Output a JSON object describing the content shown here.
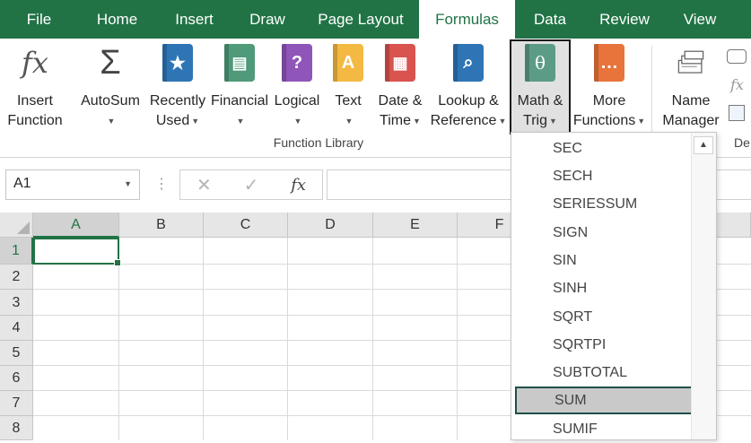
{
  "menu": {
    "tabs": [
      {
        "label": "File"
      },
      {
        "label": "Home"
      },
      {
        "label": "Insert"
      },
      {
        "label": "Draw"
      },
      {
        "label": "Page Layout"
      },
      {
        "label": "Formulas",
        "active": true
      },
      {
        "label": "Data"
      },
      {
        "label": "Review"
      },
      {
        "label": "View"
      }
    ]
  },
  "ribbon": {
    "insert_function": {
      "line1": "Insert",
      "line2": "Function",
      "icon": "fx"
    },
    "autosum": {
      "line1": "AutoSum",
      "icon": "Σ"
    },
    "recently_used": {
      "line1": "Recently",
      "line2": "Used",
      "icon": "★"
    },
    "financial": {
      "line1": "Financial",
      "icon": "▤"
    },
    "logical": {
      "line1": "Logical",
      "icon": "?"
    },
    "text": {
      "line1": "Text",
      "icon": "A"
    },
    "date_time": {
      "line1": "Date &",
      "line2": "Time",
      "icon": "▦"
    },
    "lookup_reference": {
      "line1": "Lookup &",
      "line2": "Reference",
      "icon": "⌕"
    },
    "math_trig": {
      "line1": "Math &",
      "line2": "Trig",
      "icon": "θ"
    },
    "more_functions": {
      "line1": "More",
      "line2": "Functions",
      "icon": "…"
    },
    "name_manager": {
      "line1": "Name",
      "line2": "Manager"
    },
    "group_label": "Function Library",
    "next_group_label": "De"
  },
  "colors": {
    "brand_green": "#217346",
    "insert_fn_icon": "#555555",
    "recently_used": "#2e75b6",
    "financial": "#4e9a79",
    "logical": "#8f55b8",
    "text": "#f4b942",
    "date_time": "#d9534f",
    "lookup_reference": "#2e75b6",
    "math_trig": "#5c9c86",
    "more_functions": "#e8743b",
    "highlight_border": "#1f4f4c"
  },
  "formula_bar": {
    "name_box": "A1",
    "cancel_icon": "✕",
    "enter_icon": "✓",
    "fx_label": "fx",
    "formula": ""
  },
  "grid": {
    "columns": [
      "A",
      "B",
      "C",
      "D",
      "E",
      "F"
    ],
    "rows": [
      "1",
      "2",
      "3",
      "4",
      "5",
      "6",
      "7",
      "8"
    ],
    "active_cell": "A1"
  },
  "dropdown": {
    "items": [
      "SEC",
      "SECH",
      "SERIESSUM",
      "SIGN",
      "SIN",
      "SINH",
      "SQRT",
      "SQRTPI",
      "SUBTOTAL",
      "SUM",
      "SUMIF"
    ],
    "highlighted": "SUM",
    "scroll_up_icon": "▲"
  }
}
